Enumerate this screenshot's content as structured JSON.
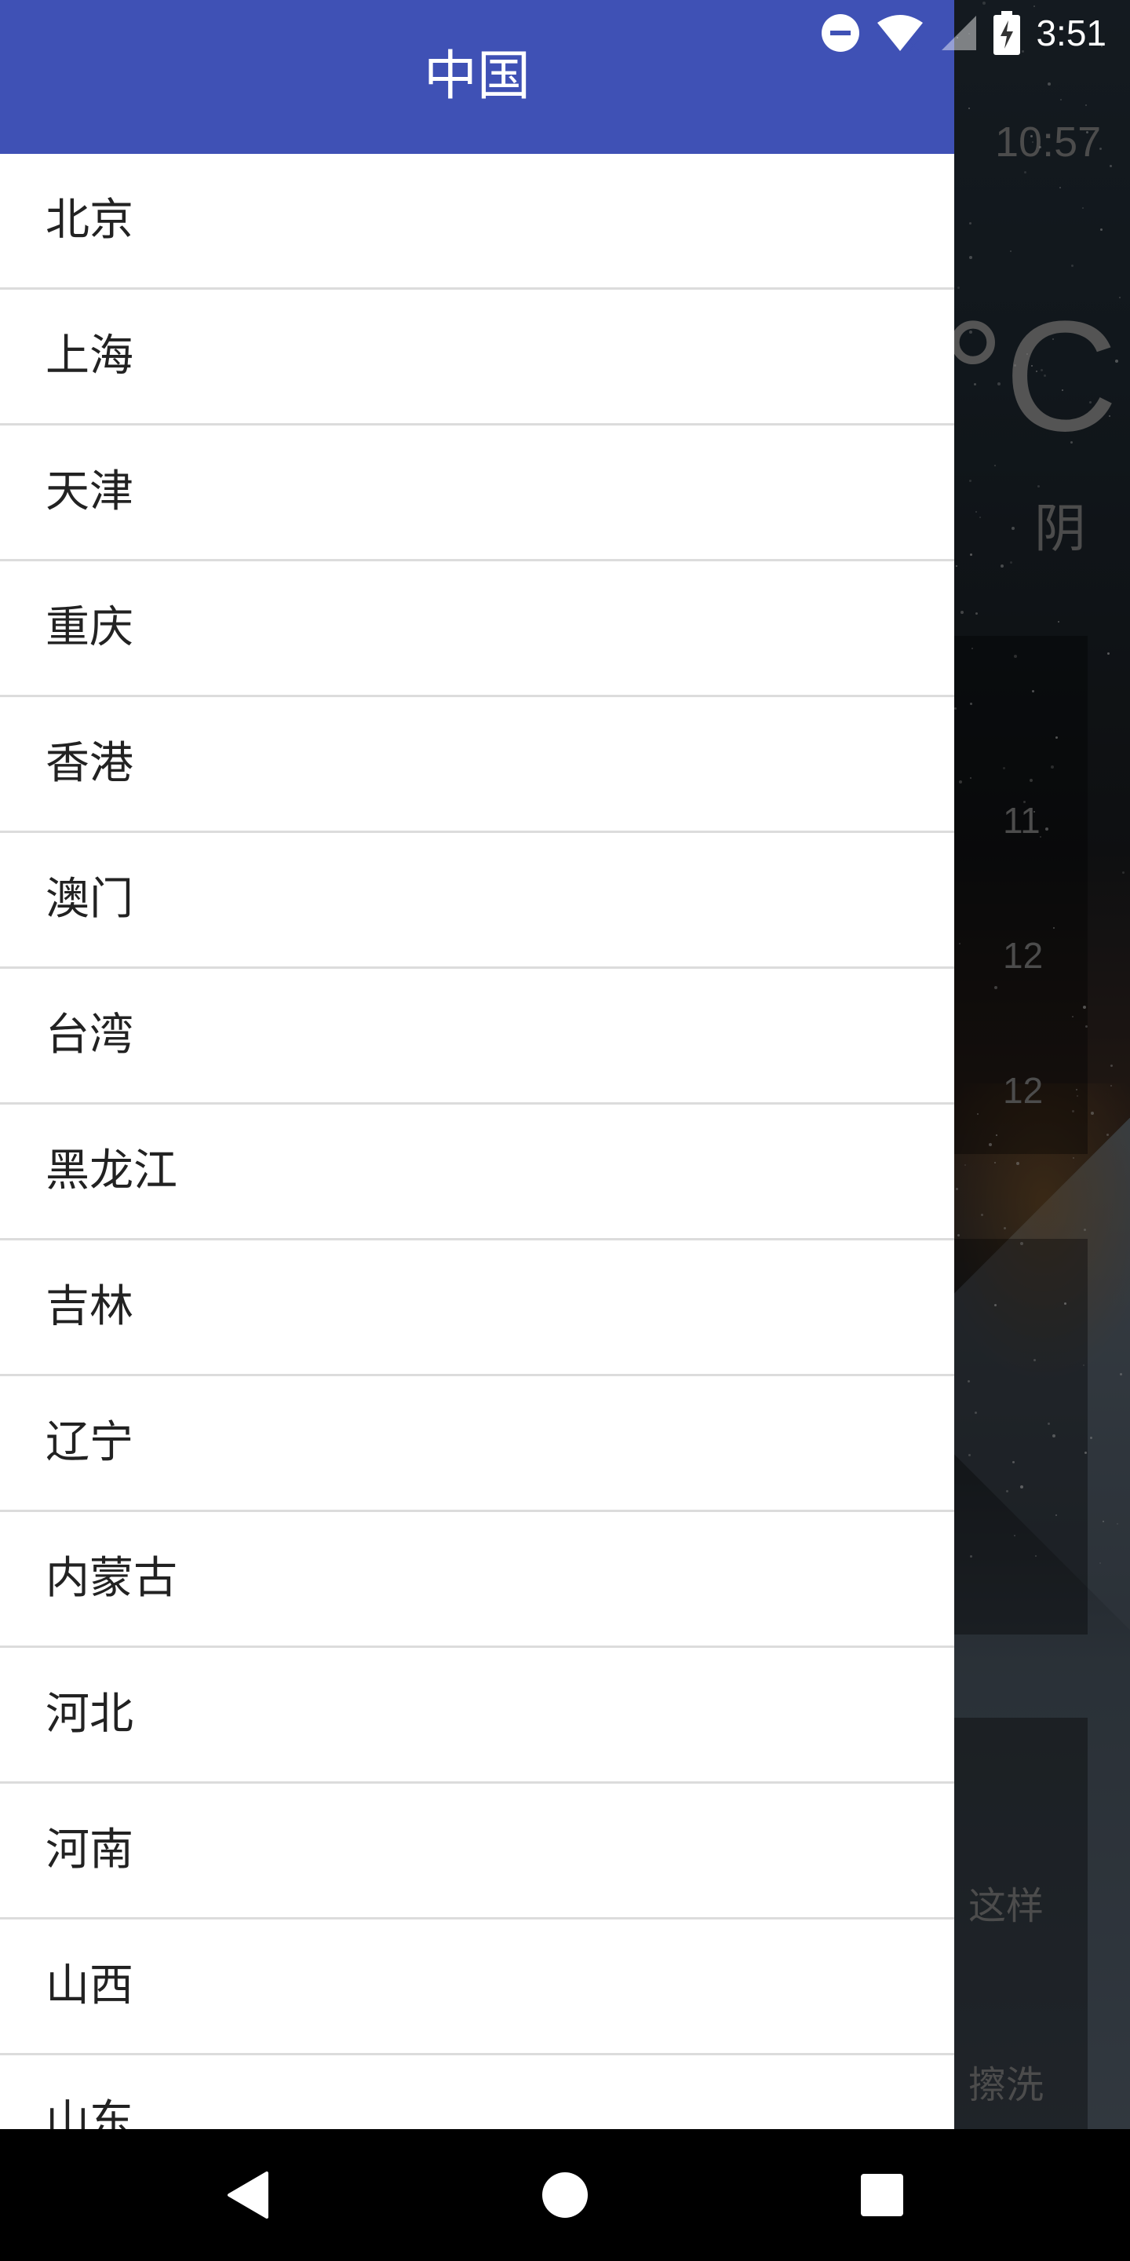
{
  "status_bar": {
    "time": "3:51"
  },
  "background_app": {
    "time": "10:57",
    "temp_unit": "°C",
    "condition": "阴",
    "forecast_values": [
      "11",
      "12",
      "12"
    ],
    "suggestion_fragment_1": "这样",
    "suggestion_fragment_2": "擦洗"
  },
  "drawer": {
    "title": "中国",
    "provinces": [
      "北京",
      "上海",
      "天津",
      "重庆",
      "香港",
      "澳门",
      "台湾",
      "黑龙江",
      "吉林",
      "辽宁",
      "内蒙古",
      "河北",
      "河南",
      "山西",
      "山东"
    ]
  },
  "colors": {
    "header": "#3f51b5",
    "divider": "#dcdcdc"
  },
  "nav_bar": {
    "icons": [
      "back-icon",
      "home-icon",
      "recents-icon"
    ]
  }
}
